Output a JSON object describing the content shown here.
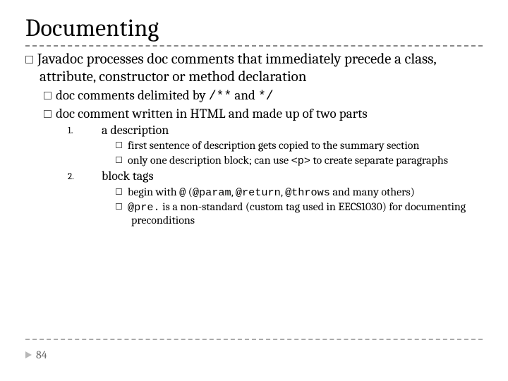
{
  "title": "Documenting",
  "bullets": {
    "l1": "Javadoc processes doc comments that immediately precede a class, attribute, constructor or method declaration",
    "l2a_pre": "doc comments delimited by ",
    "l2a_code1": "/**",
    "l2a_mid": " and ",
    "l2a_code2": "*/",
    "l2b": "doc comment written in HTML and made up of two parts",
    "n1": "1.",
    "p1": "a description",
    "p1a": "first sentence of description gets copied to the summary section",
    "p1b_pre": "only one description block; can use ",
    "p1b_code": "<p>",
    "p1b_post": " to create separate paragraphs",
    "n2": "2.",
    "p2": "block tags",
    "p2a_pre": "begin with ",
    "p2a_at": "@",
    "p2a_open": " (",
    "p2a_c1": "@param",
    "p2a_s1": ", ",
    "p2a_c2": "@return",
    "p2a_s2": ", ",
    "p2a_c3": "@throws",
    "p2a_post": " and many others)",
    "p2b_code": "@pre.",
    "p2b_post": " is a non-standard (custom tag used in EECS1030) for documenting preconditions"
  },
  "slide_number": "84"
}
